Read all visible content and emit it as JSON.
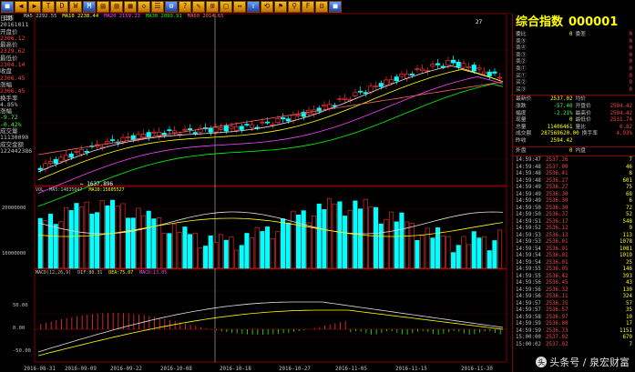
{
  "toolbar": {
    "buttons": [
      "■",
      "◀",
      "▶",
      "T",
      "D",
      "W",
      "M",
      "▤",
      "▥",
      "▦",
      "◇",
      "☰",
      "⚙",
      "?",
      "✎",
      "⊞",
      "□",
      "↔",
      "⇧",
      "⟲",
      "⚑",
      "⚲",
      "F",
      "⊟",
      "■"
    ]
  },
  "period": "日线",
  "ma_legend": [
    {
      "text": "MA5 2292.55",
      "color": "#c0c0c0"
    },
    {
      "text": "MA10 2238.44",
      "color": "#ffff00"
    },
    {
      "text": "MA20 2159.23",
      "color": "#ff40ff"
    },
    {
      "text": "MA30 2099.91",
      "color": "#00ff00"
    },
    {
      "text": "MA60 2014.65",
      "color": "#ff6060"
    }
  ],
  "left_panel": [
    {
      "t": "日期",
      "c": "lbl"
    },
    {
      "t": "20161011",
      "c": "lbl"
    },
    {
      "t": "开盘价",
      "c": "lbl"
    },
    {
      "t": "2306.12",
      "c": "up"
    },
    {
      "t": "最高价",
      "c": "lbl"
    },
    {
      "t": "2329.62",
      "c": "up"
    },
    {
      "t": "最低价",
      "c": "lbl"
    },
    {
      "t": "2304.14",
      "c": "up"
    },
    {
      "t": "收盘",
      "c": "lbl"
    },
    {
      "t": "2306.45",
      "c": "up"
    },
    {
      "t": "涨幅",
      "c": "lbl"
    },
    {
      "t": "2306.45",
      "c": "up"
    },
    {
      "t": "换手率",
      "c": "lbl"
    },
    {
      "t": "4.85%",
      "c": "lbl"
    },
    {
      "t": "涨幅",
      "c": "lbl"
    },
    {
      "t": "-9.72",
      "c": "dn"
    },
    {
      "t": "-0.42%",
      "c": "dn"
    },
    {
      "t": "成交量",
      "c": "lbl"
    },
    {
      "t": "11130090",
      "c": "lbl"
    },
    {
      "t": "成交金额",
      "c": "lbl"
    },
    {
      "t": "122442386",
      "c": "lbl"
    }
  ],
  "vol_legend": [
    {
      "text": "VOL",
      "color": "#c0c0c0"
    },
    {
      "text": "MA5:14035047",
      "color": "#c0c0c0"
    },
    {
      "text": "MA10:15605527",
      "color": "#ffff00"
    }
  ],
  "macd_legend": [
    {
      "text": "MACD(12,26,9)",
      "color": "#c0c0c0"
    },
    {
      "text": "DIF:80.31",
      "color": "#c0c0c0"
    },
    {
      "text": "DEA:75.07",
      "color": "#ffff00"
    },
    {
      "text": "MACD:13.05",
      "color": "#ff40ff"
    }
  ],
  "price_marks": {
    "high": "27",
    "low": "1637.896"
  },
  "y_axis_vol": [
    "20000000",
    "10000000"
  ],
  "y_axis_macd": [
    "50.00",
    "0.00",
    "-50.00"
  ],
  "x_labels": [
    "2016-08-31",
    "2016-09-09",
    "2016-09-22",
    "2016-10-08",
    "2016-10-18",
    "2016-10-27",
    "2016-11-05",
    "2016-11-15",
    "2016-11-30"
  ],
  "right": {
    "name": "综合指数",
    "code": "000001",
    "bidask": [
      {
        "k": "委比",
        "v": "0",
        "k2": "委差",
        "v2": "0"
      },
      {
        "k": "卖⑤",
        "v": "",
        "k2": "",
        "v2": "0"
      },
      {
        "k": "卖④",
        "v": "",
        "k2": "",
        "v2": "0"
      },
      {
        "k": "卖③",
        "v": "",
        "k2": "",
        "v2": "0"
      },
      {
        "k": "卖②",
        "v": "",
        "k2": "",
        "v2": "0"
      },
      {
        "k": "卖①",
        "v": "",
        "k2": "",
        "v2": "0"
      },
      {
        "k": "买①",
        "v": "",
        "k2": "",
        "v2": "0"
      },
      {
        "k": "买②",
        "v": "",
        "k2": "",
        "v2": "0"
      },
      {
        "k": "买③",
        "v": "",
        "k2": "",
        "v2": "0"
      }
    ],
    "quote": [
      {
        "k": "最新价",
        "v": "2537.02",
        "k2": "均价",
        "v2": ""
      },
      {
        "k": "涨跌",
        "v": "-57.40",
        "k2": "开盘价",
        "v2": "2594.42"
      },
      {
        "k": "幅度",
        "v": "-2.21%",
        "k2": "最高价",
        "v2": "2594.42"
      },
      {
        "k": "现量",
        "v": "0",
        "k2": "最低价",
        "v2": "2531.74"
      },
      {
        "k": "总量",
        "v": "11406461",
        "k2": "量比",
        "v2": "0.82"
      },
      {
        "k": "成交额",
        "v": "287569620.00",
        "k2": "换手率",
        "v2": "4.93%"
      },
      {
        "k": "昨收",
        "v": "2594.42",
        "k2": "",
        "v2": ""
      }
    ],
    "outer_inner": {
      "k": "外盘",
      "v": "0",
      "k2": "内盘",
      "v2": ""
    },
    "ticks": [
      {
        "t": "14:59:47",
        "p": "2537.26",
        "v": "7"
      },
      {
        "t": "14:59:48",
        "p": "2537.00",
        "v": "46"
      },
      {
        "t": "14:59:48",
        "p": "2536.41",
        "v": "8"
      },
      {
        "t": "14:59:48",
        "p": "2536.27",
        "v": "601"
      },
      {
        "t": "14:59:49",
        "p": "2536.27",
        "v": "75"
      },
      {
        "t": "14:59:49",
        "p": "2536.30",
        "v": "68"
      },
      {
        "t": "14:59:49",
        "p": "2536.30",
        "v": "6"
      },
      {
        "t": "14:59:50",
        "p": "2536.30",
        "v": "72"
      },
      {
        "t": "14:59:50",
        "p": "2536.37",
        "v": "52"
      },
      {
        "t": "14:59:51",
        "p": "2536.17",
        "v": "548"
      },
      {
        "t": "14:59:52",
        "p": "2536.12",
        "v": "9"
      },
      {
        "t": "14:59:53",
        "p": "2536.13",
        "v": "113"
      },
      {
        "t": "14:59:53",
        "p": "2536.01",
        "v": "1078"
      },
      {
        "t": "14:59:54",
        "p": "2536.01",
        "v": "1081"
      },
      {
        "t": "14:59:54",
        "p": "2536.01",
        "v": "1019"
      },
      {
        "t": "14:59:54",
        "p": "2536.01",
        "v": "25"
      },
      {
        "t": "14:59:55",
        "p": "2536.05",
        "v": "146"
      },
      {
        "t": "14:59:55",
        "p": "2536.42",
        "v": "393"
      },
      {
        "t": "14:59:56",
        "p": "2536.45",
        "v": "43"
      },
      {
        "t": "14:59:56",
        "p": "2536.32",
        "v": "130"
      },
      {
        "t": "14:59:56",
        "p": "2536.11",
        "v": "324"
      },
      {
        "t": "14:59:57",
        "p": "2536.35",
        "v": "57"
      },
      {
        "t": "14:59:57",
        "p": "2536.57",
        "v": "35"
      },
      {
        "t": "14:59:58",
        "p": "2536.97",
        "v": "10"
      },
      {
        "t": "14:59:59",
        "p": "2536.80",
        "v": "17"
      },
      {
        "t": "14:59:59",
        "p": "2536.73",
        "v": "1151"
      },
      {
        "t": "15:00:00",
        "p": "2537.02",
        "v": "679"
      },
      {
        "t": "15:00:02",
        "p": "2537.02",
        "v": "7"
      }
    ]
  },
  "watermark": {
    "icon": "头",
    "text": "头条号 / 泉宏财富"
  }
}
